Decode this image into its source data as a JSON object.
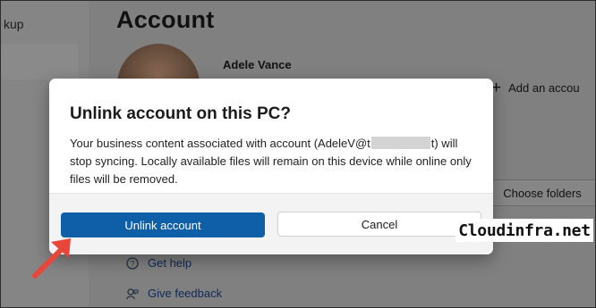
{
  "background": {
    "sidebar_fragment": "kup",
    "page_title": "Account",
    "user_name": "Adele Vance",
    "add_account_label": "Add an accou",
    "choose_folders_label": "Choose folders",
    "links": [
      {
        "label": "Get help",
        "icon": "help-icon"
      },
      {
        "label": "Give feedback",
        "icon": "feedback-icon"
      }
    ]
  },
  "dialog": {
    "title": "Unlink account on this PC?",
    "body_start": "Your business content associated with account (AdeleV@t",
    "body_end": "t) will stop syncing. Locally available files will remain on this device while online only files will be removed.",
    "primary_button": "Unlink account",
    "secondary_button": "Cancel"
  },
  "watermark": "Cloudinfra.net",
  "colors": {
    "primary": "#0f5ea8",
    "arrow": "#e8463a",
    "overlay": "#808080"
  }
}
